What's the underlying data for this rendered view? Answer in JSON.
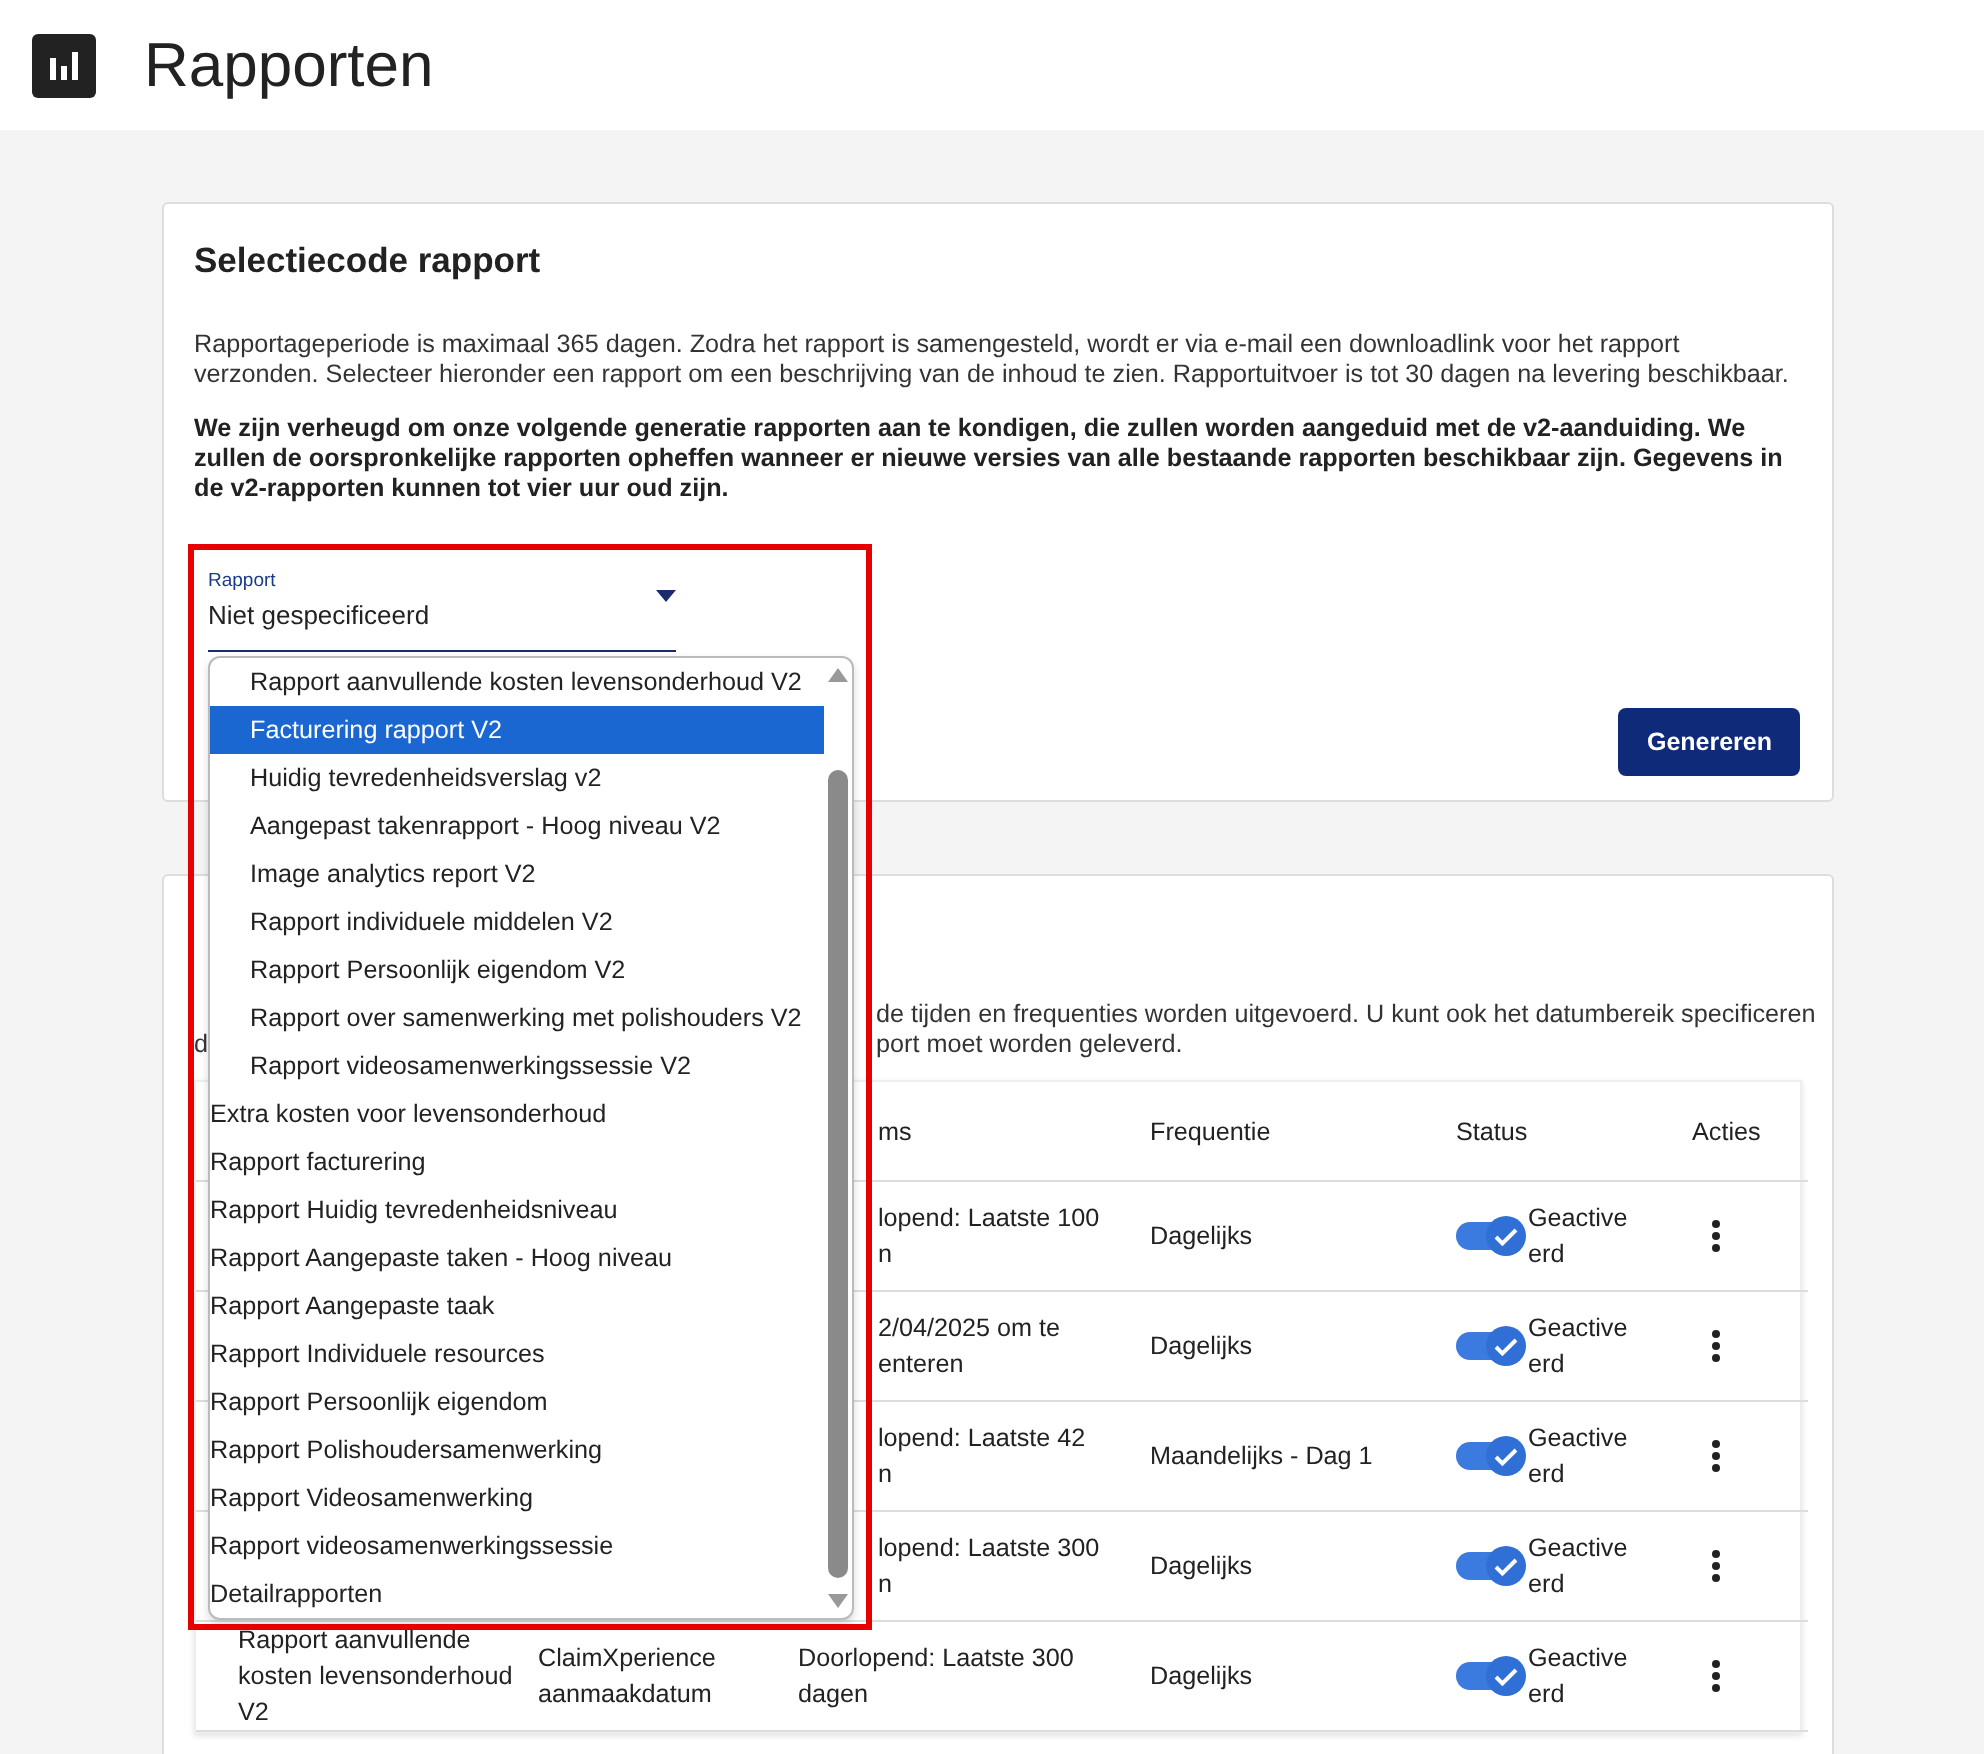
{
  "header": {
    "title": "Rapporten"
  },
  "selection_card": {
    "title": "Selectiecode rapport",
    "paragraphs": [
      "Rapportageperiode is maximaal 365 dagen. Zodra het rapport is samengesteld, wordt er via e-mail een downloadlink voor het rapport verzonden. Selecteer hieronder een rapport om een beschrijving van de inhoud te zien. Rapportuitvoer is tot 30 dagen na levering beschikbaar."
    ],
    "notice": "We zijn verheugd om onze volgende generatie rapporten aan te kondigen, die zullen worden aangeduid met de v2-aanduiding. We zullen de oorspronkelijke rapporten opheffen wanneer er nieuwe versies van alle bestaande rapporten beschikbaar zijn. Gegevens in de v2-rapporten kunnen tot vier uur oud zijn.",
    "select": {
      "label": "Rapport",
      "value": "Niet gespecificeerd",
      "expanded": true
    },
    "button": "Genereren"
  },
  "dropdown": [
    {
      "label": "Rapport aanvullende kosten levensonderhoud V2",
      "kind": "sub",
      "selected": false
    },
    {
      "label": "Facturering rapport V2",
      "kind": "sub",
      "selected": true
    },
    {
      "label": "Huidig tevredenheidsverslag v2",
      "kind": "sub",
      "selected": false
    },
    {
      "label": "Aangepast takenrapport - Hoog niveau V2",
      "kind": "sub",
      "selected": false
    },
    {
      "label": "Image analytics report V2",
      "kind": "sub",
      "selected": false
    },
    {
      "label": "Rapport individuele middelen V2",
      "kind": "sub",
      "selected": false
    },
    {
      "label": "Rapport Persoonlijk eigendom V2",
      "kind": "sub",
      "selected": false
    },
    {
      "label": "Rapport over samenwerking met polishouders V2",
      "kind": "sub",
      "selected": false
    },
    {
      "label": "Rapport videosamenwerkingssessie V2",
      "kind": "sub",
      "selected": false
    },
    {
      "label": "Extra kosten voor levensonderhoud",
      "kind": "top",
      "selected": false
    },
    {
      "label": "Rapport facturering",
      "kind": "top",
      "selected": false
    },
    {
      "label": "Rapport Huidig tevredenheidsniveau",
      "kind": "top",
      "selected": false
    },
    {
      "label": "Rapport Aangepaste taken - Hoog niveau",
      "kind": "top",
      "selected": false
    },
    {
      "label": "Rapport Aangepaste taak",
      "kind": "top",
      "selected": false
    },
    {
      "label": "Rapport Individuele resources",
      "kind": "top",
      "selected": false
    },
    {
      "label": "Rapport Persoonlijk eigendom",
      "kind": "top",
      "selected": false
    },
    {
      "label": "Rapport Polishoudersamenwerking",
      "kind": "top",
      "selected": false
    },
    {
      "label": "Rapport Videosamenwerking",
      "kind": "top",
      "selected": false
    },
    {
      "label": "Rapport videosamenwerkingssessie",
      "kind": "top",
      "selected": false
    },
    {
      "label": "Detailrapporten",
      "kind": "top",
      "selected": false
    }
  ],
  "schedule_card": {
    "intro_left": [
      "d"
    ],
    "intro_right": [
      "de tijden en frequenties worden uitgevoerd. U kunt ook het datumbereik specificeren",
      "port moet worden geleverd."
    ],
    "columns": [
      "ms",
      "Frequentie",
      "Status",
      "Acties"
    ],
    "rows": [
      {
        "kind": "covered",
        "range": [
          "lopend: Laatste 100",
          "n"
        ],
        "frequency": "Dagelijks",
        "on": true,
        "status": "Geactiveerd"
      },
      {
        "kind": "covered",
        "range": [
          "2/04/2025 om te",
          "enteren"
        ],
        "frequency": "Dagelijks",
        "on": true,
        "status": "Geactiveerd"
      },
      {
        "kind": "covered",
        "range": [
          "lopend: Laatste 42",
          "n"
        ],
        "frequency": "Maandelijks - Dag 1",
        "on": true,
        "status": "Geactiveerd"
      },
      {
        "kind": "covered",
        "range": [
          "lopend: Laatste 300",
          "n"
        ],
        "frequency": "Dagelijks",
        "on": true,
        "status": "Geactiveerd"
      },
      {
        "kind": "full",
        "name": "Rapport aanvullende kosten levensonderhoud V2",
        "date_field": "ClaimXperience aanmaakdatum",
        "range": [
          "Doorlopend: Laatste 300 dagen"
        ],
        "frequency": "Dagelijks",
        "on": true,
        "status": "Geactiveerd"
      }
    ]
  }
}
